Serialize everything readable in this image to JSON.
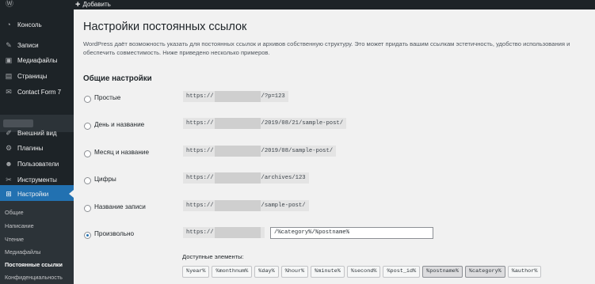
{
  "adminbar": {
    "new_label": "Добавить"
  },
  "sidebar": {
    "items": [
      {
        "label": "Консоль",
        "icon": "dashboard-icon",
        "glyph": "◔"
      },
      {
        "label": "Записи",
        "icon": "pin-icon",
        "glyph": "✎"
      },
      {
        "label": "Медиафайлы",
        "icon": "media-icon",
        "glyph": "▣"
      },
      {
        "label": "Страницы",
        "icon": "pages-icon",
        "glyph": "▤"
      },
      {
        "label": "Contact Form 7",
        "icon": "mail-icon",
        "glyph": "✉"
      },
      {
        "label": "Внешний вид",
        "icon": "brush-icon",
        "glyph": "✐"
      },
      {
        "label": "Плагины",
        "icon": "plugin-icon",
        "glyph": "⚙"
      },
      {
        "label": "Пользователи",
        "icon": "users-icon",
        "glyph": "☻"
      },
      {
        "label": "Инструменты",
        "icon": "tools-icon",
        "glyph": "✂"
      },
      {
        "label": "Настройки",
        "icon": "settings-icon",
        "glyph": "⊞"
      }
    ],
    "submenu": [
      {
        "label": "Общие"
      },
      {
        "label": "Написание"
      },
      {
        "label": "Чтение"
      },
      {
        "label": "Медиафайлы"
      },
      {
        "label": "Постоянные ссылки"
      },
      {
        "label": "Конфиденциальность"
      }
    ]
  },
  "main": {
    "title": "Настройки постоянных ссылок",
    "description": "WordPress даёт возможность указать для постоянных ссылок и архивов собственную структуру. Это может придать вашим ссылкам эстетичность, удобство использования и обеспечить совместимость. Ниже приведено несколько примеров.",
    "section_title": "Общие настройки",
    "options": [
      {
        "label": "Простые",
        "prefix": "https://",
        "suffix": "/?p=123",
        "checked": false
      },
      {
        "label": "День и название",
        "prefix": "https://",
        "suffix": "/2019/08/21/sample-post/",
        "checked": false
      },
      {
        "label": "Месяц и название",
        "prefix": "https://",
        "suffix": "/2019/08/sample-post/",
        "checked": false
      },
      {
        "label": "Цифры",
        "prefix": "https://",
        "suffix": "/archives/123",
        "checked": false
      },
      {
        "label": "Название записи",
        "prefix": "https://",
        "suffix": "/sample-post/",
        "checked": false
      },
      {
        "label": "Произвольно",
        "prefix": "https://",
        "suffix": "",
        "checked": true
      }
    ],
    "custom_structure": "/%category%/%postname%",
    "available_label": "Доступные элементы:",
    "tags": [
      "%year%",
      "%monthnum%",
      "%day%",
      "%hour%",
      "%minute%",
      "%second%",
      "%post_id%",
      "%postname%",
      "%category%",
      "%author%"
    ],
    "active_tags": [
      "%postname%",
      "%category%"
    ]
  },
  "colors": {
    "accent": "#2271b1",
    "sidebar_bg": "#1d2327",
    "page_bg": "#f1f1f1"
  }
}
